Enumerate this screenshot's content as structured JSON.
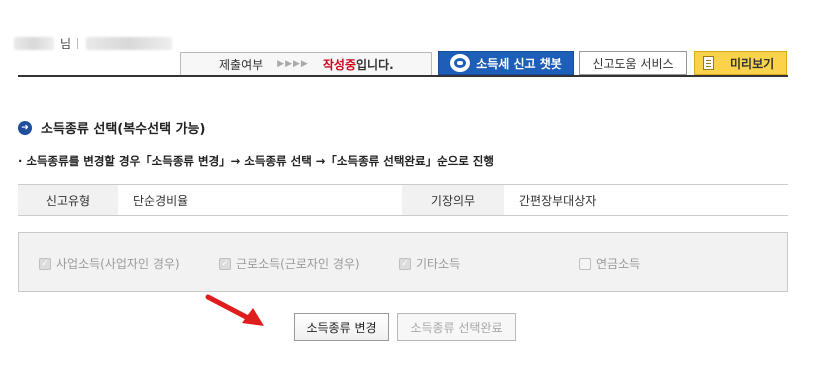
{
  "user": {
    "honorific": "님"
  },
  "status": {
    "label": "제출여부",
    "arrows": "▶▶▶▶",
    "state": "작성중",
    "suffix": "입니다."
  },
  "header_buttons": {
    "chatbot": "소득세 신고 챗봇",
    "help": "신고도움 서비스",
    "preview": "미리보기"
  },
  "section": {
    "title": "소득종류 선택(복수선택 가능)",
    "icon_glyph": "➜",
    "notice": "· 소득종류를 변경할 경우「소득종류 변경」→ 소득종류 선택 →「소득종류 선택완료」순으로 진행"
  },
  "info": {
    "type_label": "신고유형",
    "type_value": "단순경비율",
    "duty_label": "기장의무",
    "duty_value": "간편장부대상자"
  },
  "options": [
    {
      "label": "사업소득(사업자인 경우)",
      "checked": true,
      "check_glyph": "✓"
    },
    {
      "label": "근로소득(근로자인 경우)",
      "checked": true,
      "check_glyph": "✓"
    },
    {
      "label": "기타소득",
      "checked": true,
      "check_glyph": "✓"
    },
    {
      "label": "연금소득",
      "checked": false,
      "check_glyph": ""
    }
  ],
  "buttons": {
    "change": "소득종류 변경",
    "complete": "소득종류 선택완료"
  },
  "colors": {
    "accent_red": "#d0021b",
    "chatbot_blue": "#1d5fb8",
    "preview_yellow": "#fbd34a",
    "pointer_arrow": "#e01d1d"
  }
}
